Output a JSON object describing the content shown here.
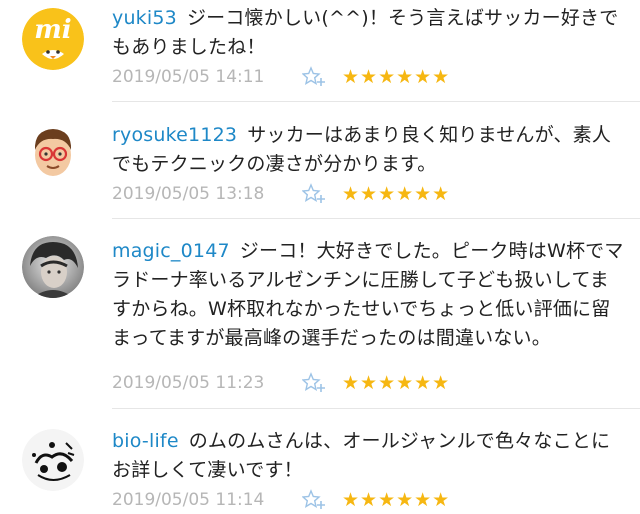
{
  "comments": [
    {
      "username": "yuki53",
      "text": "ジーコ懐かしい(^^)！そう言えばサッカー好きでもありましたね！",
      "timestamp": "2019/05/05 14:11",
      "stars": "★★★★★★",
      "avatar_icon": "mi-logo-avatar"
    },
    {
      "username": "ryosuke1123",
      "text": "サッカーはあまり良く知りませんが、素人でもテクニックの凄さが分かります。",
      "timestamp": "2019/05/05 13:18",
      "stars": "★★★★★★",
      "avatar_icon": "cartoon-man-avatar"
    },
    {
      "username": "magic_0147",
      "text": "ジーコ！大好きでした。ピーク時はW杯でマラドーナ率いるアルゼンチンに圧勝して子ども扱いしてますからね。W杯取れなかったせいでちょっと低い評価に留まってますが最高峰の選手だったのは間違いない。",
      "timestamp": "2019/05/05 11:23",
      "stars": "★★★★★★",
      "avatar_icon": "photo-avatar"
    },
    {
      "username": "bio-life",
      "text": "のムのムさんは、オールジャンルで色々なことにお詳しくて凄いです！",
      "timestamp": "2019/05/05 11:14",
      "stars": "★★★★★★",
      "avatar_icon": "ink-drawing-avatar"
    }
  ],
  "colors": {
    "username": "#1e88c7",
    "timestamp": "#b6b6b6",
    "star": "#f6b712",
    "fav_icon": "#9dc3e6"
  }
}
